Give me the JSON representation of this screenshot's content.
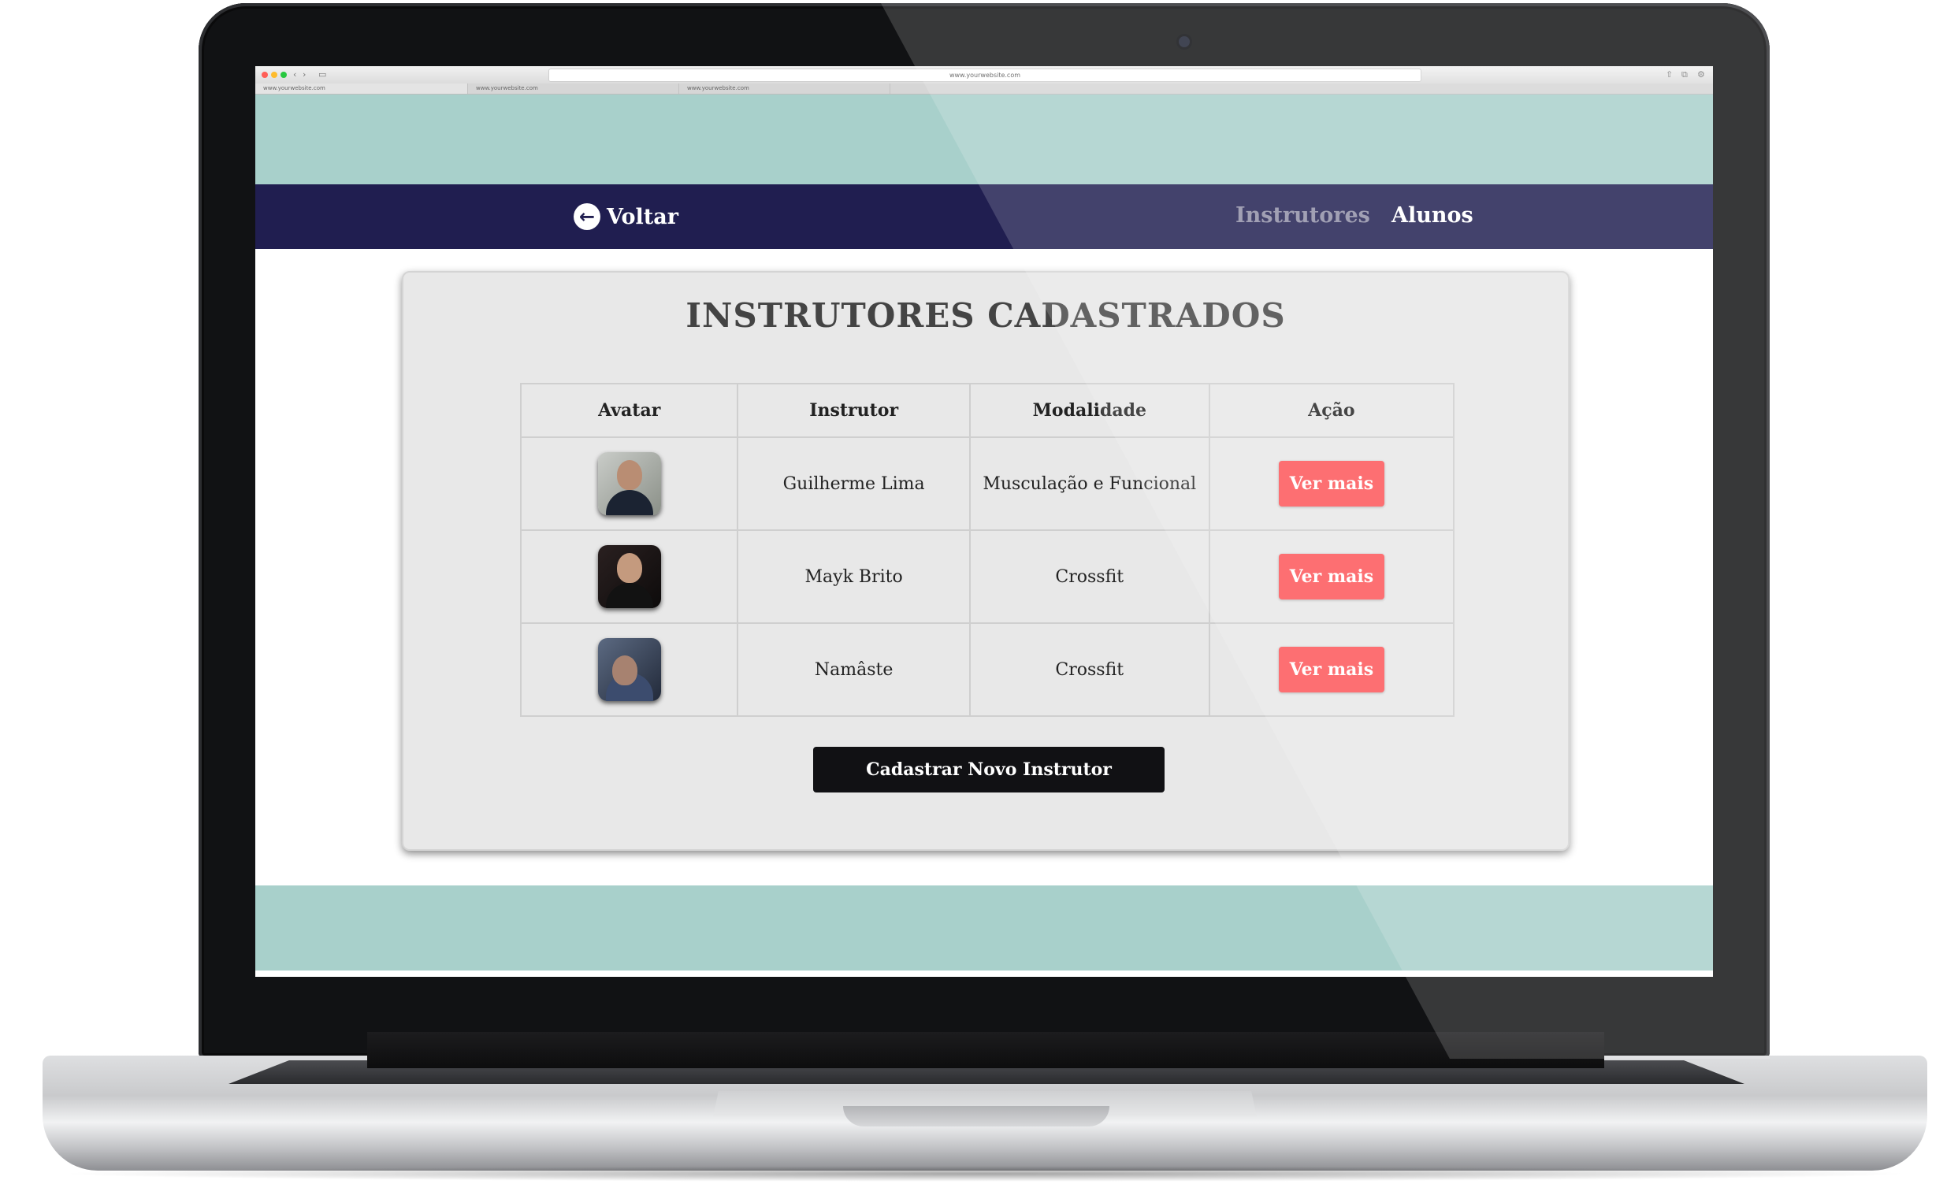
{
  "browser": {
    "url": "www.yourwebsite.com",
    "tabs": [
      "www.yourwebsite.com",
      "www.yourwebsite.com",
      "www.yourwebsite.com"
    ]
  },
  "navbar": {
    "back_label": "Voltar",
    "links": [
      {
        "label": "Instrutores",
        "active": false
      },
      {
        "label": "Alunos",
        "active": true
      }
    ]
  },
  "content": {
    "title": "INSTRUTORES CADASTRADOS",
    "table": {
      "headers": [
        "Avatar",
        "Instrutor",
        "Modalidade",
        "Ação"
      ],
      "rows": [
        {
          "instrutor": "Guilherme Lima",
          "modalidade": "Musculação e Funcional",
          "acao": "Ver mais"
        },
        {
          "instrutor": "Mayk Brito",
          "modalidade": "Crossfit",
          "acao": "Ver mais"
        },
        {
          "instrutor": "Namâste",
          "modalidade": "Crossfit",
          "acao": "Ver mais"
        }
      ]
    },
    "new_button": "Cadastrar Novo Instrutor"
  },
  "colors": {
    "teal_band": "#a8d0cb",
    "navbar": "#201e50",
    "action_button": "#fd5457",
    "primary_button": "#111114"
  }
}
